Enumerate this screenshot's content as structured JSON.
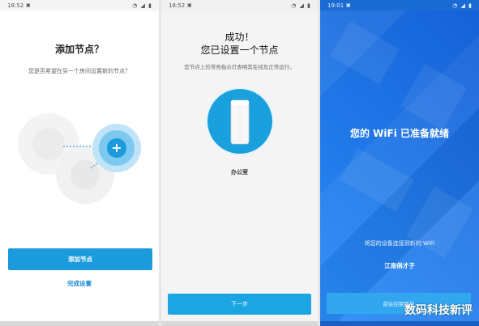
{
  "screens": [
    {
      "status_time": "18:52",
      "title": "添加节点？",
      "subtitle": "您是否希望在另一个房间设置新的节点？",
      "primary_button": "添加节点",
      "secondary_link": "完成设置"
    },
    {
      "status_time": "18:52",
      "title_line1": "成功！",
      "title_line2": "您已设置一个节点",
      "subtitle": "您节点上的常亮指示灯表明其在线及正常运行。",
      "node_label": "办公室",
      "primary_button": "下一步"
    },
    {
      "status_time": "19:01",
      "title": "您的 WiFi 已准备就绪",
      "subtitle": "将您的设备连接到新的 WiFi",
      "wifi_name": "江南俏才子",
      "primary_button": "前往控制面板"
    }
  ],
  "watermark": "数码科技新评",
  "colors": {
    "accent_blue": "#1b9bdc",
    "screen3_background": "#1f7cf2"
  }
}
